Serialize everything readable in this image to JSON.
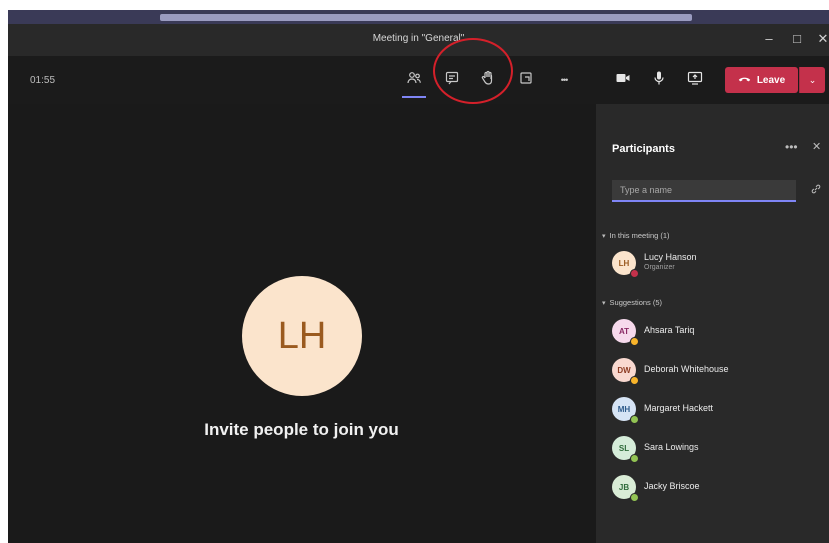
{
  "window": {
    "title": "Meeting in \"General\"",
    "minimize_glyph": "–",
    "maximize_glyph": "□",
    "close_glyph": "✕"
  },
  "toolbar": {
    "timer": "01:55",
    "icons": [
      "participants-icon",
      "chat-icon",
      "raise-hand-icon",
      "room-icon",
      "more-icon"
    ],
    "more_glyph": "•••"
  },
  "controls": {
    "leave_label": "Leave",
    "leave_caret": "⌄",
    "icons": [
      "camera-icon",
      "microphone-icon",
      "share-screen-icon"
    ]
  },
  "stage": {
    "avatar_initials": "LH",
    "invite_text": "Invite people to join you"
  },
  "participants": {
    "title": "Participants",
    "more_glyph": "•••",
    "close_glyph": "✕",
    "search_placeholder": "Type a name",
    "in_meeting_header": "In this meeting (1)",
    "in_meeting": [
      {
        "initials": "LH",
        "name": "Lucy Hanson",
        "role": "Organizer",
        "avatar_bg": "#fbe4cc",
        "avatar_fg": "#9a5a1f",
        "status_color": "#c4314b"
      }
    ],
    "suggestions_header": "Suggestions (5)",
    "suggestions": [
      {
        "initials": "AT",
        "name": "Ahsara Tariq",
        "avatar_bg": "#f6d9ec",
        "avatar_fg": "#8a2a66",
        "status_color": "#f8b42a"
      },
      {
        "initials": "DW",
        "name": "Deborah Whitehouse",
        "avatar_bg": "#f9d9d0",
        "avatar_fg": "#8c3b22",
        "status_color": "#f8b42a"
      },
      {
        "initials": "MH",
        "name": "Margaret Hackett",
        "avatar_bg": "#d6e4f5",
        "avatar_fg": "#2d5a8a",
        "status_color": "#92c353"
      },
      {
        "initials": "SL",
        "name": "Sara Lowings",
        "avatar_bg": "#d5ecd9",
        "avatar_fg": "#2f6b3a",
        "status_color": "#92c353"
      },
      {
        "initials": "JB",
        "name": "Jacky Briscoe",
        "avatar_bg": "#d9ecd6",
        "avatar_fg": "#2f6b3a",
        "status_color": "#92c353"
      }
    ]
  }
}
